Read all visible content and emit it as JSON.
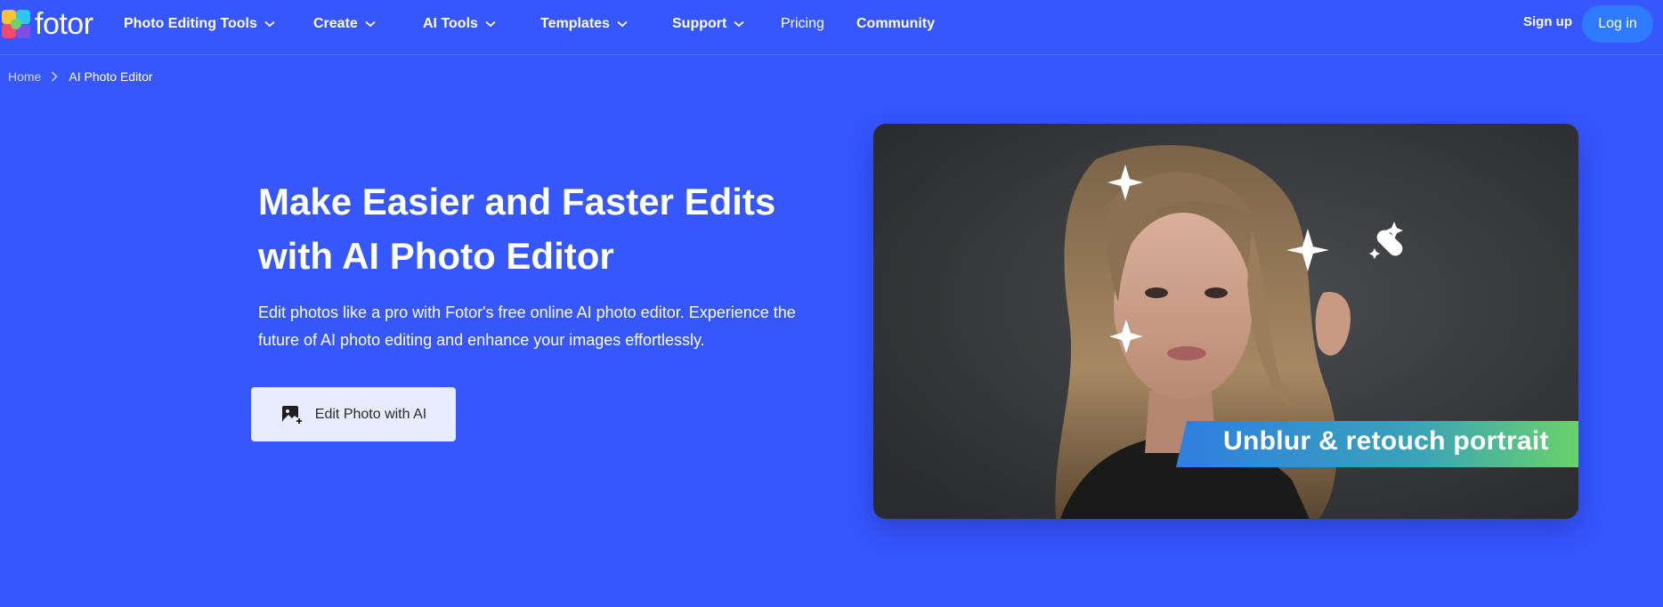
{
  "header": {
    "brand": "fotor",
    "nav": [
      {
        "label": "Photo Editing Tools",
        "has_dropdown": true
      },
      {
        "label": "Create",
        "has_dropdown": true
      },
      {
        "label": "AI Tools",
        "has_dropdown": true
      },
      {
        "label": "Templates",
        "has_dropdown": true
      },
      {
        "label": "Support",
        "has_dropdown": true
      },
      {
        "label": "Pricing",
        "has_dropdown": false
      },
      {
        "label": "Community",
        "has_dropdown": false
      }
    ],
    "signup_label": "Sign up",
    "login_label": "Log in"
  },
  "breadcrumb": {
    "home": "Home",
    "current": "AI Photo Editor"
  },
  "hero": {
    "title_line1": "Make Easier and Faster Edits",
    "title_line2": "with AI Photo Editor",
    "description": "Edit photos like a pro with Fotor's free online AI photo editor. Experience the future of AI photo editing and enhance your images effortlessly.",
    "cta_label": "Edit Photo with AI",
    "cta_icon": "image-add-icon"
  },
  "showcase": {
    "banner_text": "Unblur & retouch portrait",
    "icons": [
      "sparkle-icon",
      "bandage-sparkle-icon"
    ]
  },
  "colors": {
    "background": "#3656fe",
    "login_button": "#2f7bff",
    "cta_background": "#e8ecff",
    "banner_start": "#2f7ee0",
    "banner_end": "#6ad26a"
  }
}
